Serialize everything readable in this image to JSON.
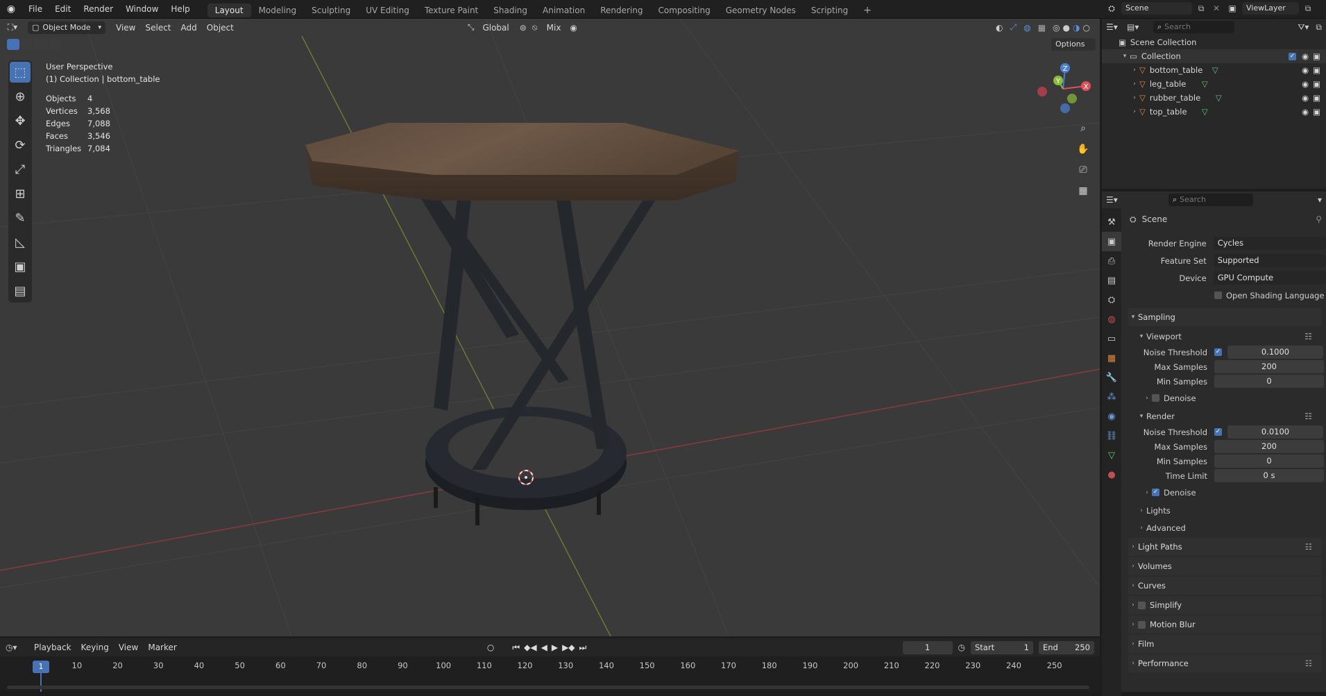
{
  "topbar": {
    "menus": [
      "File",
      "Edit",
      "Render",
      "Window",
      "Help"
    ],
    "workspaces": [
      "Layout",
      "Modeling",
      "Sculpting",
      "UV Editing",
      "Texture Paint",
      "Shading",
      "Animation",
      "Rendering",
      "Compositing",
      "Geometry Nodes",
      "Scripting"
    ],
    "active_workspace": "Layout",
    "add_tab": "+",
    "scene_name": "Scene",
    "viewlayer_name": "ViewLayer"
  },
  "viewport_header": {
    "mode": "Object Mode",
    "menus": [
      "View",
      "Select",
      "Add",
      "Object"
    ],
    "orientation": "Global",
    "mix": "Mix",
    "options": "Options"
  },
  "viewport": {
    "title": "User Perspective",
    "subtitle": "(1) Collection | bottom_table",
    "stats": [
      {
        "label": "Objects",
        "value": "4"
      },
      {
        "label": "Vertices",
        "value": "3,568"
      },
      {
        "label": "Edges",
        "value": "7,088"
      },
      {
        "label": "Faces",
        "value": "3,546"
      },
      {
        "label": "Triangles",
        "value": "7,084"
      }
    ],
    "gizmo": {
      "x": "X",
      "y": "Y",
      "z": "Z"
    },
    "colors": {
      "x_axis": "#e0505a",
      "y_axis": "#8cbc3a",
      "z_axis": "#4a7fd4",
      "active_tool": "#4772b3"
    }
  },
  "outliner": {
    "search_placeholder": "Search",
    "scene_collection": "Scene Collection",
    "collection": "Collection",
    "objects": [
      "bottom_table",
      "leg_table",
      "rubber_table",
      "top_table"
    ]
  },
  "properties": {
    "search_placeholder": "Search",
    "context": "Scene",
    "render_engine_label": "Render Engine",
    "render_engine": "Cycles",
    "feature_set_label": "Feature Set",
    "feature_set": "Supported",
    "device_label": "Device",
    "device": "GPU Compute",
    "osl_label": "Open Shading Language",
    "sampling": "Sampling",
    "viewport_section": "Viewport",
    "noise_threshold_label": "Noise Threshold",
    "viewport_noise_threshold": "0.1000",
    "max_samples_label": "Max Samples",
    "viewport_max_samples": "200",
    "min_samples_label": "Min Samples",
    "viewport_min_samples": "0",
    "denoise_label": "Denoise",
    "render_section": "Render",
    "render_noise_threshold": "0.0100",
    "render_max_samples": "200",
    "render_min_samples": "0",
    "time_limit_label": "Time Limit",
    "time_limit": "0 s",
    "lights": "Lights",
    "advanced": "Advanced",
    "panels": [
      "Light Paths",
      "Volumes",
      "Curves",
      "Simplify",
      "Motion Blur",
      "Film",
      "Performance"
    ]
  },
  "timeline": {
    "menus": [
      "Playback",
      "Keying",
      "View",
      "Marker"
    ],
    "current_frame": "1",
    "start_label": "Start",
    "start": "1",
    "end_label": "End",
    "end": "250",
    "ticks": [
      "1",
      "10",
      "20",
      "30",
      "40",
      "50",
      "60",
      "70",
      "80",
      "90",
      "100",
      "110",
      "120",
      "130",
      "140",
      "150",
      "160",
      "170",
      "180",
      "190",
      "200",
      "210",
      "220",
      "230",
      "240",
      "250"
    ]
  }
}
